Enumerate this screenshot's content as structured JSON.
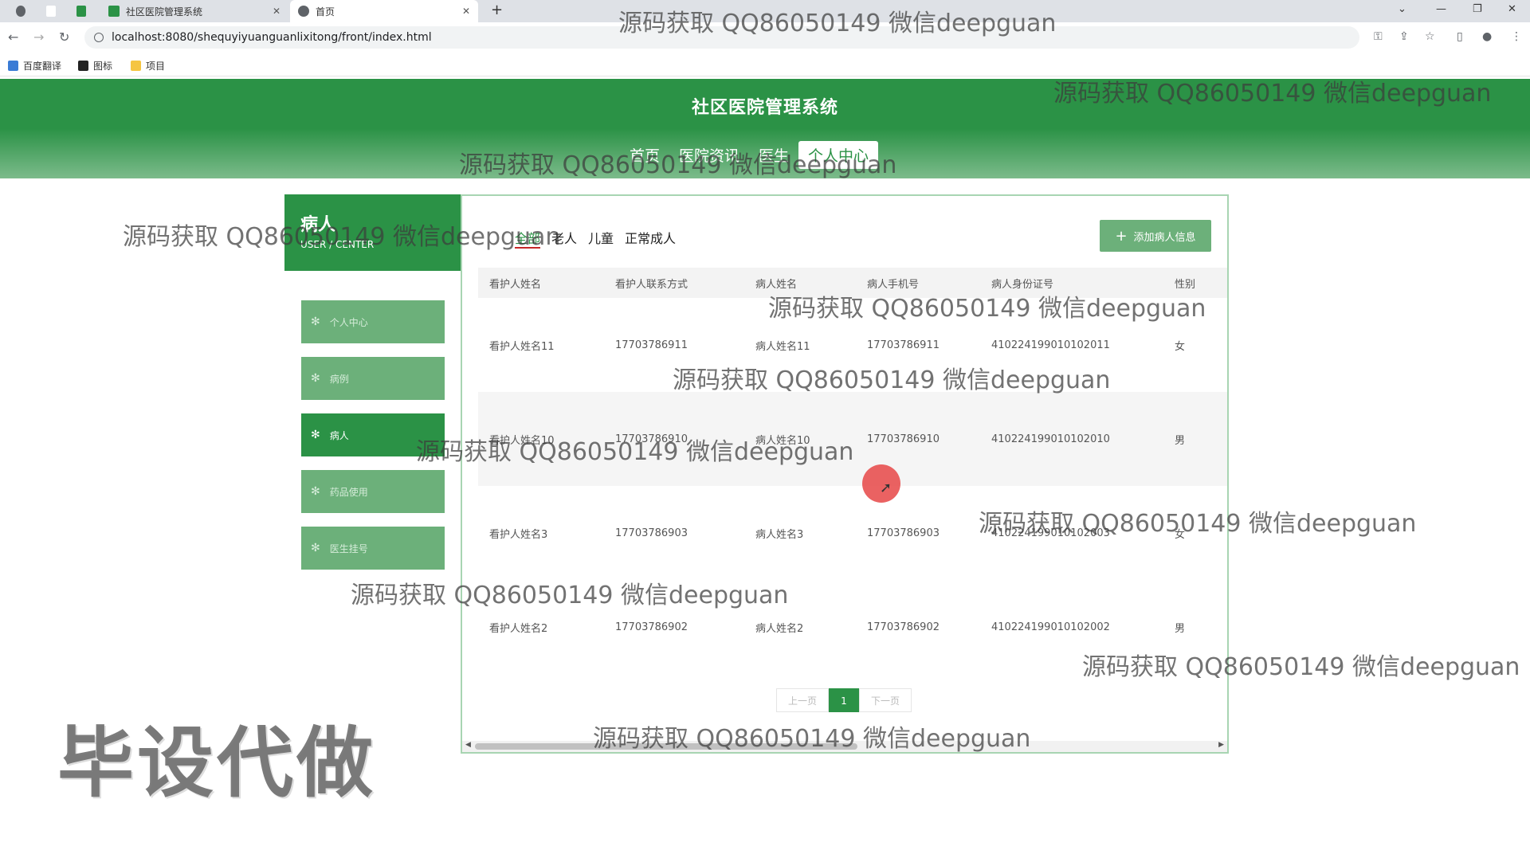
{
  "browser": {
    "tabs": [
      {
        "label": ""
      },
      {
        "label": ""
      },
      {
        "label": ""
      },
      {
        "label": "社区医院管理系统"
      },
      {
        "label": "首页"
      }
    ],
    "url": "localhost:8080/shequyiyuanguanlixitong/front/index.html",
    "bookmarks": [
      "百度翻译",
      "图标",
      "项目"
    ]
  },
  "site": {
    "title": "社区医院管理系统",
    "nav": [
      "首页",
      "医院资讯",
      "医生",
      "个人中心"
    ],
    "active_nav": "个人中心"
  },
  "sidebar": {
    "title": "病人",
    "subtitle": "USER / CENTER",
    "items": [
      {
        "label": "个人中心",
        "active": false
      },
      {
        "label": "病例",
        "active": false
      },
      {
        "label": "病人",
        "active": true
      },
      {
        "label": "药品使用",
        "active": false
      },
      {
        "label": "医生挂号",
        "active": false
      }
    ]
  },
  "main": {
    "filters": [
      "全部",
      "老人",
      "儿童",
      "正常成人"
    ],
    "active_filter": "全部",
    "add_button": "添加病人信息",
    "columns": [
      "看护人姓名",
      "看护人联系方式",
      "病人姓名",
      "病人手机号",
      "病人身份证号",
      "性别"
    ],
    "rows": [
      [
        "看护人姓名11",
        "17703786911",
        "病人姓名11",
        "17703786911",
        "410224199010102011",
        "女"
      ],
      [
        "看护人姓名10",
        "17703786910",
        "病人姓名10",
        "17703786910",
        "410224199010102010",
        "男"
      ],
      [
        "看护人姓名3",
        "17703786903",
        "病人姓名3",
        "17703786903",
        "410224199010102003",
        "女"
      ],
      [
        "看护人姓名2",
        "17703786902",
        "病人姓名2",
        "17703786902",
        "410224199010102002",
        "男"
      ]
    ],
    "pager": {
      "prev": "上一页",
      "current": "1",
      "next": "下一页"
    }
  },
  "watermarks": {
    "text": "源码获取 QQ86050149 微信deepguan",
    "big": "毕设代做"
  },
  "colors": {
    "primary": "#2b9246",
    "secondary": "#6cb07a"
  }
}
